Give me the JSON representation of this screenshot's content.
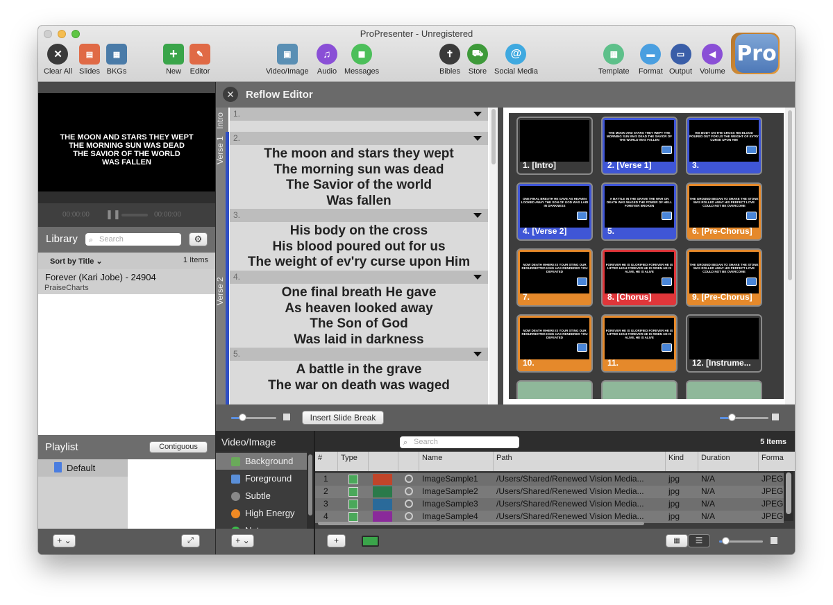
{
  "window": {
    "title": "ProPresenter - Unregistered"
  },
  "toolbar": {
    "clear_all": "Clear All",
    "slides": "Slides",
    "bkgs": "BKGs",
    "new": "New",
    "editor": "Editor",
    "video_image": "Video/Image",
    "audio": "Audio",
    "messages": "Messages",
    "bibles": "Bibles",
    "store": "Store",
    "social_media": "Social Media",
    "template": "Template",
    "format": "Format",
    "output": "Output",
    "volume": "Volume",
    "logo_text": "Pro"
  },
  "preview": {
    "lines": [
      "THE MOON AND STARS THEY WEPT",
      "THE MORNING SUN WAS DEAD",
      "THE SAVIOR OF THE WORLD",
      "WAS FALLEN"
    ],
    "time_left": "00:00:00",
    "time_right": "00:00:00"
  },
  "library": {
    "title": "Library",
    "search_placeholder": "Search",
    "sort_label": "Sort by Title",
    "count": "1 Items",
    "item_title": "Forever (Kari Jobe) - 24904",
    "item_source": "PraiseCharts"
  },
  "playlist": {
    "title": "Playlist",
    "mode_button": "Contiguous",
    "default_item": "Default"
  },
  "reflow": {
    "title": "Reflow Editor",
    "groups": [
      {
        "name": "Intro"
      },
      {
        "name": "Verse 1"
      },
      {
        "name": "Verse 2"
      }
    ],
    "slides": [
      {
        "num": "1.",
        "lines": []
      },
      {
        "num": "2.",
        "lines": [
          "The moon and stars they wept",
          "The morning sun was dead",
          "The Savior of the world",
          "Was fallen"
        ]
      },
      {
        "num": "3.",
        "lines": [
          "His body on the cross",
          "His blood poured out for us",
          "The weight of ev'ry curse upon Him"
        ]
      },
      {
        "num": "4.",
        "lines": [
          "One final breath He gave",
          "As heaven looked away",
          "The Son of God",
          "Was laid in darkness"
        ]
      },
      {
        "num": "5.",
        "lines": [
          "A battle in the grave",
          "The war on death was waged"
        ]
      }
    ],
    "insert_break_button": "Insert Slide Break"
  },
  "slide_grid": {
    "thumbs": [
      {
        "label": "1. [Intro]",
        "color": "#3a3a3a",
        "text": ""
      },
      {
        "label": "2. [Verse 1]",
        "color": "#3f56d6",
        "text": "THE MOON AND STARS THEY WEPT THE MORNING SUN WAS DEAD THE SAVIOR OF THE WORLD WAS FALLEN"
      },
      {
        "label": "3.",
        "color": "#3f56d6",
        "text": "HIS BODY ON THE CROSS HIS BLOOD POURED OUT FOR US THE WEIGHT OF EV'RY CURSE UPON HIM"
      },
      {
        "label": "4. [Verse 2]",
        "color": "#3f56d6",
        "text": "ONE FINAL BREATH HE GAVE AS HEAVEN LOOKED AWAY THE SON OF GOD WAS LAID IN DARKNESS"
      },
      {
        "label": "5.",
        "color": "#3f56d6",
        "text": "A BATTLE IN THE GRAVE THE WAR ON DEATH WAS WAGED THE POWER OF HELL FOREVER BROKEN"
      },
      {
        "label": "6. [Pre-Chorus]",
        "color": "#e5892b",
        "text": "THE GROUND BEGAN TO SHAKE THE STONE WAS ROLLED AWAY HIS PERFECT LOVE COULD NOT BE OVERCOME"
      },
      {
        "label": "7.",
        "color": "#e5892b",
        "text": "NOW DEATH WHERE IS YOUR STING OUR RESURRECTED KING HAS RENDERED YOU DEFEATED"
      },
      {
        "label": "8. [Chorus]",
        "color": "#e0363a",
        "text": "FOREVER HE IS GLORIFIED FOREVER HE IS LIFTED HIGH FOREVER HE IS RISEN HE IS ALIVE, HE IS ALIVE"
      },
      {
        "label": "9. [Pre-Chorus]",
        "color": "#e5892b",
        "text": "THE GROUND BEGAN TO SHAKE THE STONE WAS ROLLED AWAY HIS PERFECT LOVE COULD NOT BE OVERCOME"
      },
      {
        "label": "10.",
        "color": "#e5892b",
        "text": "NOW DEATH WHERE IS YOUR STING OUR RESURRECTED KING HAS RENDERED YOU DEFEATED"
      },
      {
        "label": "11.",
        "color": "#e5892b",
        "text": "FOREVER HE IS GLORIFIED FOREVER HE IS LIFTED HIGH FOREVER HE IS RISEN HE IS ALIVE, HE IS ALIVE"
      },
      {
        "label": "12. [Instrume...",
        "color": "#3a3a3a",
        "text": ""
      }
    ]
  },
  "media": {
    "title": "Video/Image",
    "categories": [
      {
        "label": "Background",
        "color": "#6aaa5a"
      },
      {
        "label": "Foreground",
        "color": "#5a8fd8"
      },
      {
        "label": "Subtle",
        "color": "#888888"
      },
      {
        "label": "High Energy",
        "color": "#f08a24"
      },
      {
        "label": "Nature",
        "color": "#3ac24a"
      }
    ],
    "search_placeholder": "Search",
    "count": "5 Items",
    "columns": [
      "#",
      "Type",
      "",
      "",
      "Name",
      "Path",
      "Kind",
      "Duration",
      "Forma"
    ],
    "rows": [
      {
        "num": "1",
        "name": "ImageSample1",
        "path": "/Users/Shared/Renewed Vision Media...",
        "kind": "jpg",
        "duration": "N/A",
        "format": "JPEG"
      },
      {
        "num": "2",
        "name": "ImageSample2",
        "path": "/Users/Shared/Renewed Vision Media...",
        "kind": "jpg",
        "duration": "N/A",
        "format": "JPEG"
      },
      {
        "num": "3",
        "name": "ImageSample3",
        "path": "/Users/Shared/Renewed Vision Media...",
        "kind": "jpg",
        "duration": "N/A",
        "format": "JPEG"
      },
      {
        "num": "4",
        "name": "ImageSample4",
        "path": "/Users/Shared/Renewed Vision Media...",
        "kind": "jpg",
        "duration": "N/A",
        "format": "JPEG"
      }
    ]
  },
  "icons": {
    "clear_all": "clear-all-icon",
    "slides": "slides-icon",
    "bkgs": "bkgs-icon",
    "new": "new-icon",
    "editor": "editor-icon",
    "video": "video-image-icon",
    "audio": "audio-icon",
    "messages": "messages-icon",
    "bibles": "bibles-icon",
    "store": "store-icon",
    "social": "social-media-icon",
    "template": "template-icon",
    "format": "format-icon",
    "output": "output-icon",
    "volume": "volume-icon"
  }
}
